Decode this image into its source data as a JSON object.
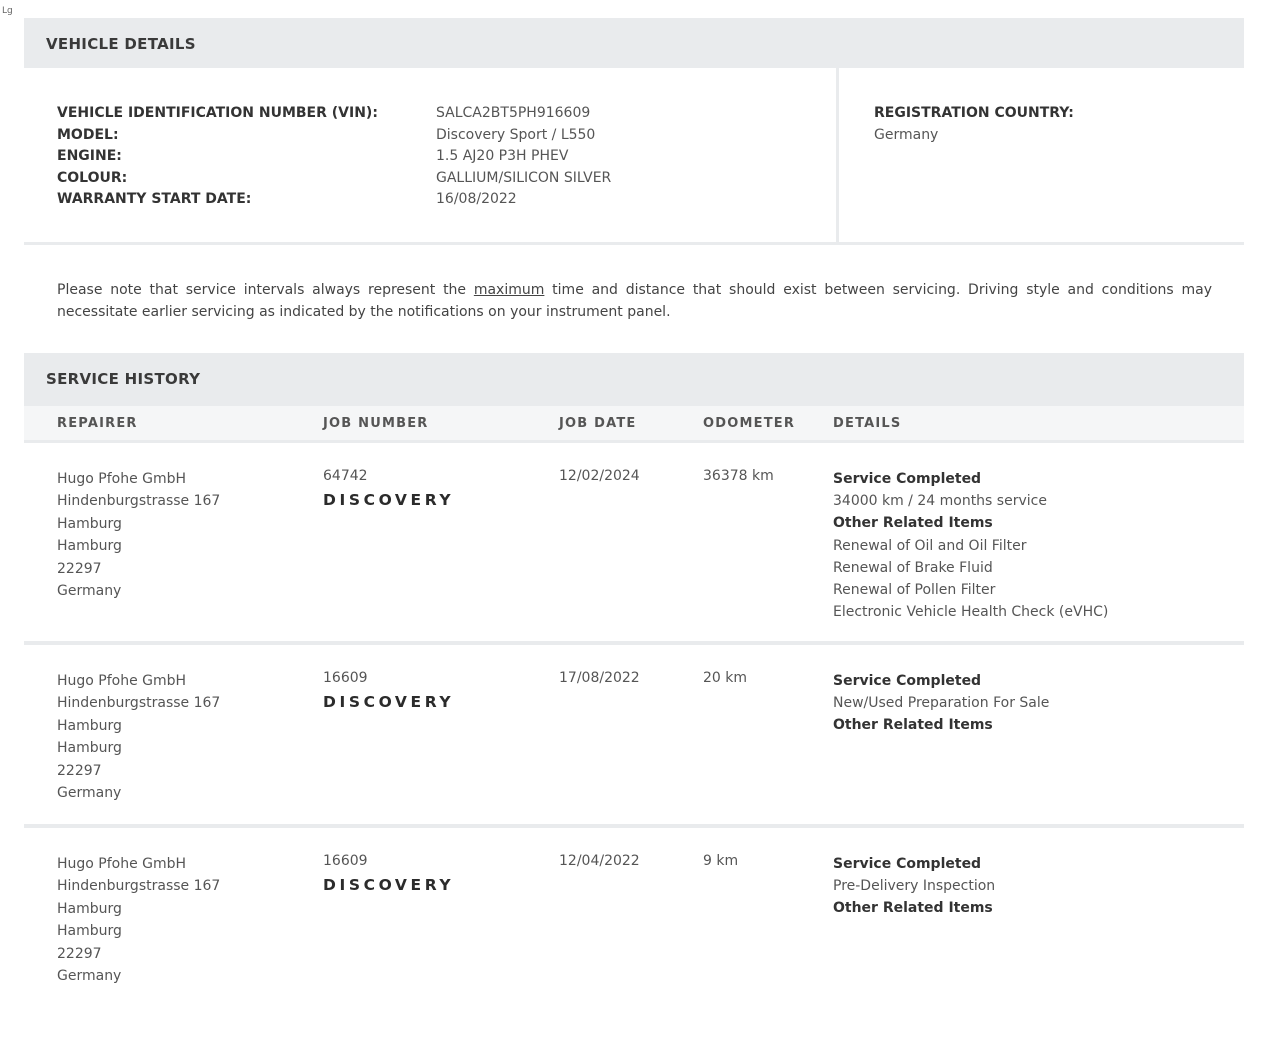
{
  "corner_mark": "Lg",
  "vehicle_details": {
    "title": "VEHICLE DETAILS",
    "fields": [
      {
        "label": "VEHICLE IDENTIFICATION NUMBER (VIN):",
        "value": "SALCA2BT5PH916609"
      },
      {
        "label": "MODEL:",
        "value": "Discovery Sport / L550"
      },
      {
        "label": "ENGINE:",
        "value": "1.5 AJ20 P3H PHEV"
      },
      {
        "label": "COLOUR:",
        "value": "GALLIUM/SILICON SILVER"
      },
      {
        "label": "WARRANTY START DATE:",
        "value": "16/08/2022"
      }
    ],
    "registration_country_label": "REGISTRATION COUNTRY:",
    "registration_country_value": "Germany"
  },
  "note": {
    "before": "Please note that service intervals always represent the ",
    "emphasis": "maximum",
    "after": " time and distance that should exist between servicing. Driving style and conditions may necessitate earlier servicing as indicated by the notifications on your instrument panel."
  },
  "service_history": {
    "title": "SERVICE HISTORY",
    "headers": {
      "repairer": "REPAIRER",
      "job_number": "JOB NUMBER",
      "job_date": "JOB DATE",
      "odometer": "ODOMETER",
      "details": "DETAILS"
    },
    "rows": [
      {
        "repairer": [
          "Hugo Pfohe GmbH",
          "Hindenburgstrasse 167",
          "Hamburg",
          "Hamburg",
          "22297",
          "Germany"
        ],
        "job_number": "64742",
        "brand": "DISCOVERY",
        "job_date": "12/02/2024",
        "odometer": "36378 km",
        "details": {
          "heading": "Service Completed",
          "service": "34000 km / 24 months service",
          "related_heading": "Other Related Items",
          "related": [
            "Renewal of Oil and Oil Filter",
            "Renewal of Brake Fluid",
            "Renewal of Pollen Filter",
            "Electronic Vehicle Health Check (eVHC)"
          ]
        }
      },
      {
        "repairer": [
          "Hugo Pfohe GmbH",
          "Hindenburgstrasse 167",
          "Hamburg",
          "Hamburg",
          "22297",
          "Germany"
        ],
        "job_number": "16609",
        "brand": "DISCOVERY",
        "job_date": "17/08/2022",
        "odometer": "20 km",
        "details": {
          "heading": "Service Completed",
          "service": "New/Used Preparation For Sale",
          "related_heading": "Other Related Items",
          "related": []
        }
      },
      {
        "repairer": [
          "Hugo Pfohe GmbH",
          "Hindenburgstrasse 167",
          "Hamburg",
          "Hamburg",
          "22297",
          "Germany"
        ],
        "job_number": "16609",
        "brand": "DISCOVERY",
        "job_date": "12/04/2022",
        "odometer": "9 km",
        "details": {
          "heading": "Service Completed",
          "service": "Pre-Delivery Inspection",
          "related_heading": "Other Related Items",
          "related": []
        }
      }
    ]
  }
}
